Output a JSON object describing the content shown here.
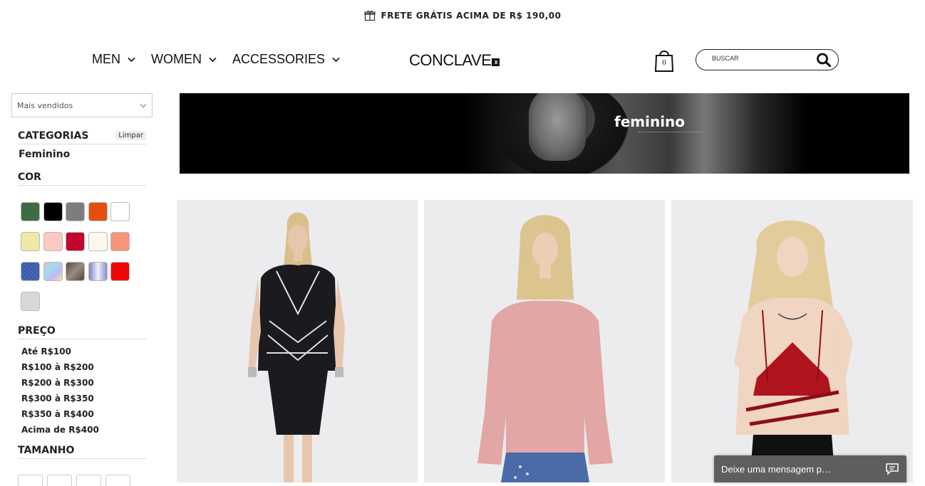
{
  "topbar": {
    "shipping_text": "FRETE GRÁTIS ACIMA DE R$ 190,00",
    "icon": "gift-icon"
  },
  "nav": {
    "items": [
      {
        "label": "MEN"
      },
      {
        "label": "WOMEN"
      },
      {
        "label": "ACCESSORIES"
      }
    ]
  },
  "logo": {
    "text": "CONCLAVE",
    "mark": "x"
  },
  "cart": {
    "count": "0",
    "icon": "shopping-bag-icon"
  },
  "search": {
    "placeholder": "BUSCAR",
    "icon": "search-icon"
  },
  "sort": {
    "selected": "Mais vendidos"
  },
  "filters": {
    "categories": {
      "title": "CATEGORIAS",
      "clear_label": "Limpar",
      "items": [
        "Feminino"
      ]
    },
    "color": {
      "title": "COR",
      "swatches": [
        "#3e6b46",
        "#000000",
        "#7d7d7d",
        "#e64e0f",
        "#ffffff",
        "#ede9a5",
        "#f9c9c2",
        "#c2072d",
        "#fcf9ea",
        "#f99478",
        "#3f5fad",
        "#c7c3e3",
        "#6e6258",
        "#b0b8d8",
        "#ef0707",
        "#d8d8d8"
      ]
    },
    "price": {
      "title": "PREÇO",
      "items": [
        "Até R$100",
        "R$100 à R$200",
        "R$200 à R$300",
        "R$300 à R$350",
        "R$350 à R$400",
        "Acima de R$400"
      ]
    },
    "size": {
      "title": "TAMANHO"
    }
  },
  "banner": {
    "title": "feminino"
  },
  "products": [
    {
      "name": "dress",
      "colors": {
        "garment": "#1b1b1f"
      }
    },
    {
      "name": "sweater",
      "colors": {
        "garment": "#e2a6a4"
      }
    },
    {
      "name": "crop top",
      "colors": {
        "garment": "#b0141e"
      }
    }
  ],
  "chat": {
    "placeholder": "Deixe uma mensagem p…",
    "icon": "chat-bubble-icon"
  }
}
